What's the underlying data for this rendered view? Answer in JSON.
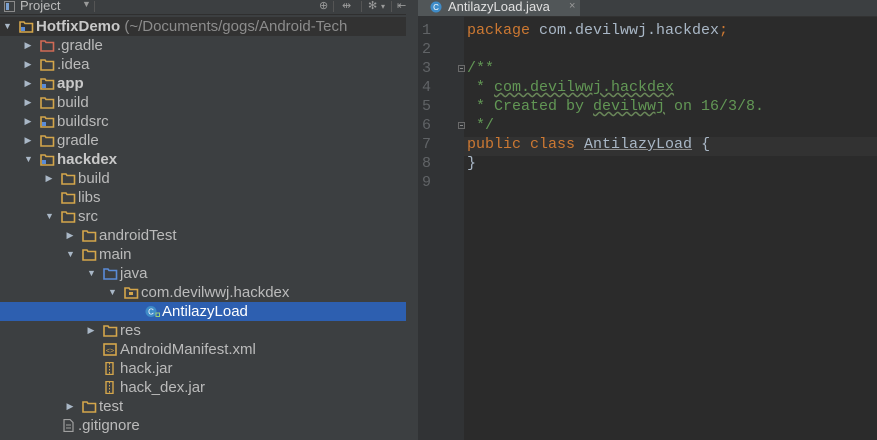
{
  "project_panel": {
    "title": "Project",
    "tree": [
      {
        "label": "HotfixDemo",
        "path": " (~/Documents/gogs/Android-Tech",
        "level": 0,
        "expanded": true,
        "icon": "module-folder-icon",
        "bold": true
      },
      {
        "label": ".gradle",
        "level": 1,
        "expanded": false,
        "icon": "excluded-folder-icon"
      },
      {
        "label": ".idea",
        "level": 1,
        "expanded": false,
        "icon": "folder-icon"
      },
      {
        "label": "app",
        "level": 1,
        "expanded": false,
        "icon": "module-folder-icon",
        "bold": true
      },
      {
        "label": "build",
        "level": 1,
        "expanded": false,
        "icon": "folder-icon"
      },
      {
        "label": "buildsrc",
        "level": 1,
        "expanded": false,
        "icon": "module-folder-icon"
      },
      {
        "label": "gradle",
        "level": 1,
        "expanded": false,
        "icon": "folder-icon"
      },
      {
        "label": "hackdex",
        "level": 1,
        "expanded": true,
        "icon": "module-folder-icon",
        "bold": true
      },
      {
        "label": "build",
        "level": 2,
        "expanded": false,
        "icon": "folder-icon"
      },
      {
        "label": "libs",
        "level": 2,
        "icon": "folder-icon"
      },
      {
        "label": "src",
        "level": 2,
        "expanded": true,
        "icon": "folder-icon"
      },
      {
        "label": "androidTest",
        "level": 3,
        "expanded": false,
        "icon": "folder-icon"
      },
      {
        "label": "main",
        "level": 3,
        "expanded": true,
        "icon": "folder-icon"
      },
      {
        "label": "java",
        "level": 4,
        "expanded": true,
        "icon": "source-folder-icon"
      },
      {
        "label": "com.devilwwj.hackdex",
        "level": 5,
        "expanded": true,
        "icon": "package-icon"
      },
      {
        "label": "AntilazyLoad",
        "level": 6,
        "icon": "java-class-icon",
        "selected": true
      },
      {
        "label": "res",
        "level": 4,
        "expanded": false,
        "icon": "resource-folder-icon"
      },
      {
        "label": "AndroidManifest.xml",
        "level": 4,
        "icon": "manifest-icon"
      },
      {
        "label": "hack.jar",
        "level": 4,
        "icon": "jar-icon"
      },
      {
        "label": "hack_dex.jar",
        "level": 4,
        "icon": "jar-icon"
      },
      {
        "label": "test",
        "level": 3,
        "expanded": false,
        "icon": "folder-icon"
      },
      {
        "label": ".gitignore",
        "level": 2,
        "icon": "text-file-icon"
      }
    ]
  },
  "editor": {
    "tab_label": "AntilazyLoad.java",
    "line_numbers": [
      "1",
      "2",
      "3",
      "4",
      "5",
      "6",
      "7",
      "8",
      "9"
    ],
    "lines": [
      [
        {
          "t": "package",
          "c": "kw"
        },
        {
          "t": " com.devilwwj.hackdex",
          "c": "pkg"
        },
        {
          "t": ";",
          "c": "kw"
        }
      ],
      [],
      [
        {
          "t": "/**",
          "c": "doc"
        }
      ],
      [
        {
          "t": " * ",
          "c": "doc"
        },
        {
          "t": "com.devilwwj.hackdex",
          "c": "doc wavy"
        }
      ],
      [
        {
          "t": " * Created by ",
          "c": "doc"
        },
        {
          "t": "devilwwj",
          "c": "doc wavy"
        },
        {
          "t": " on 16/3/8.",
          "c": "doc"
        }
      ],
      [
        {
          "t": " */",
          "c": "doc"
        }
      ],
      [
        {
          "t": "public class ",
          "c": "kw"
        },
        {
          "t": "AntilazyLoad",
          "c": "cls"
        },
        {
          "t": " {",
          "c": "pkg"
        }
      ],
      [
        {
          "t": "}",
          "c": "pkg"
        }
      ],
      []
    ]
  },
  "colors": {
    "selection": "#2d5fb0",
    "keyword": "#cc7832",
    "doc_comment": "#629755",
    "folder": "#d4a64b"
  }
}
